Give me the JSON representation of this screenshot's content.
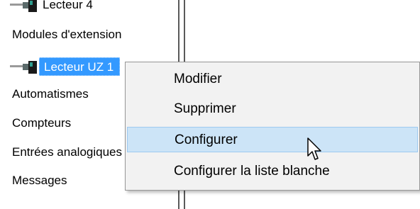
{
  "tree": {
    "items": [
      {
        "label": "Lecteur 4"
      },
      {
        "label": "Modules d'extension"
      },
      {
        "label": "Lecteur UZ 1"
      },
      {
        "label": "Automatismes"
      },
      {
        "label": "Compteurs"
      },
      {
        "label": "Entrées analogiques"
      },
      {
        "label": "Messages"
      }
    ]
  },
  "context_menu": {
    "items": [
      {
        "label": "Modifier"
      },
      {
        "label": "Supprimer"
      },
      {
        "label": "Configurer",
        "highlighted": true
      },
      {
        "label": "Configurer la liste blanche"
      }
    ]
  },
  "colors": {
    "selection": "#3399ff",
    "menu_background": "#f2f2f2",
    "menu_highlight": "#cce4f7"
  },
  "icons": [
    "device-icon",
    "arrow-cursor-icon"
  ]
}
